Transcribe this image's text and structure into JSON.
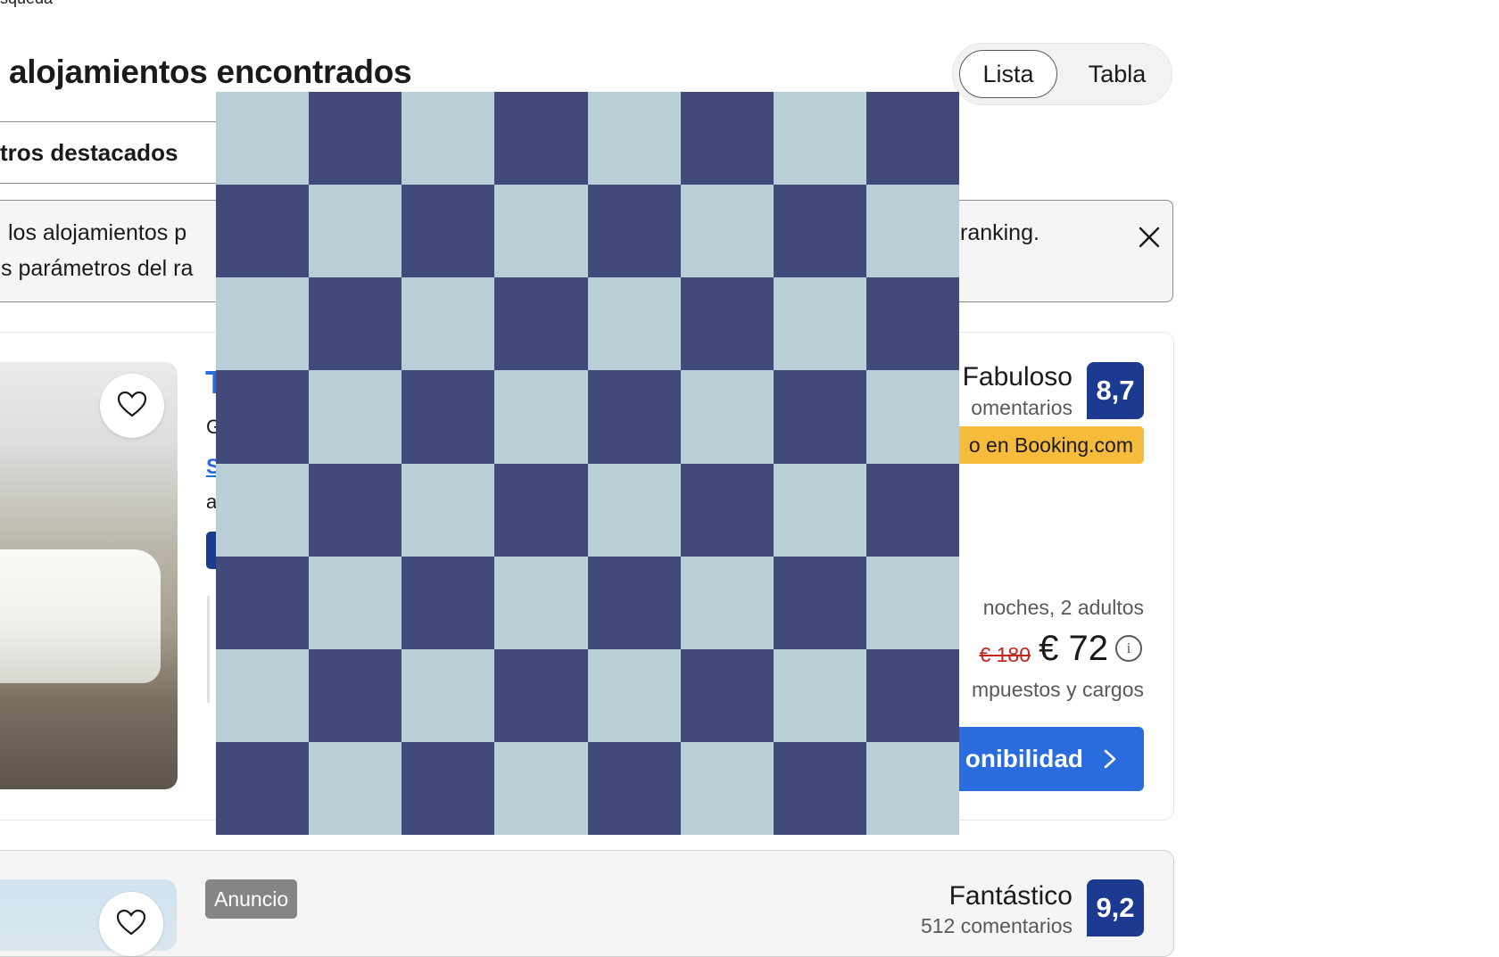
{
  "breadcrumb_fragment": "squeda",
  "results_title": "alojamientos encontrados",
  "view_toggle": {
    "active": "Lista",
    "inactive": "Tabla"
  },
  "sort_label": "tros destacados",
  "ranking_notice": {
    "line1_left": "los alojamientos p",
    "line1_right": "ranking.",
    "line2_left": "s parámetros del ra"
  },
  "listing_1": {
    "title_fragment": "T",
    "address_fragment": "G",
    "link_fragment": "S",
    "distance_fragment": "a",
    "rating_word": "Fabuloso",
    "reviews_fragment": "omentarios",
    "score": "8,7",
    "promo_badge": "o en Booking.com",
    "stay_info": "noches, 2 adultos",
    "old_price": "€ 180",
    "price": "€ 72",
    "taxes_note": "mpuestos y cargos",
    "cta_label": "onibilidad",
    "cta_icon": "chevron-right-icon",
    "favorite_icon": "heart-icon"
  },
  "listing_2": {
    "ad_label": "Anuncio",
    "rating_word": "Fantástico",
    "reviews": "512 comentarios",
    "score": "9,2",
    "favorite_icon": "heart-icon"
  },
  "notice_close_icon": "close-icon",
  "colors": {
    "brand_blue": "#1c3a8f",
    "cta_blue": "#2a6bde",
    "promo_yellow": "#f7bb3c",
    "old_price_red": "#c4241a",
    "overlay_dark": "#414a7a",
    "overlay_light": "#b8cfd8"
  }
}
